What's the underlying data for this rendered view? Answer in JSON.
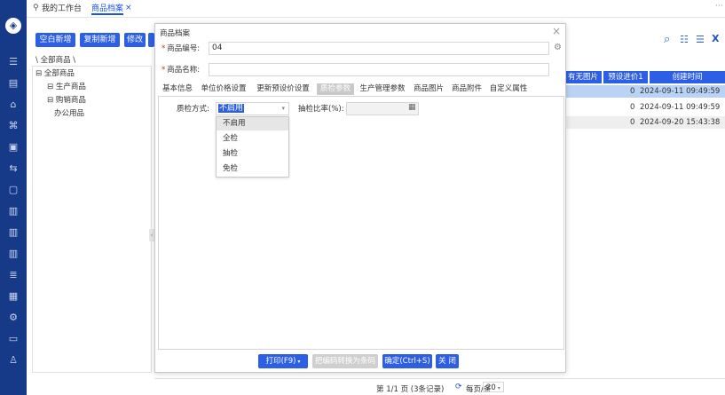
{
  "topbar": {
    "tabs": [
      {
        "label": "我的工作台",
        "active": false
      },
      {
        "label": "商品档案",
        "active": true
      }
    ],
    "more": "···"
  },
  "leftnav": {
    "icons": [
      "home-icon",
      "task-icon",
      "cart-icon",
      "bank-icon",
      "monitor-icon",
      "transfer-icon",
      "doc-icon",
      "file-icon",
      "file-icon",
      "file-icon",
      "list-icon",
      "report-icon",
      "settings-icon",
      "screen-icon",
      "user-icon"
    ]
  },
  "background": {
    "toolbar": {
      "blank_new": "空白新增",
      "copy_new": "复制新增",
      "edit": "修改"
    },
    "breadcrumb": "\\ 全部商品 \\",
    "tree": [
      "⊟ 全部商品",
      "⊟ 生产商品",
      "⊟ 购销商品",
      "办公用品"
    ],
    "grid": {
      "headers": [
        "有无图片",
        "预设进价1",
        "创建时间"
      ],
      "rows": [
        {
          "price": "0",
          "created": "2024-09-11 09:49:59"
        },
        {
          "price": "0",
          "created": "2024-09-11 09:49:59"
        },
        {
          "price": "0",
          "created": "2024-09-20 15:43:38"
        }
      ]
    },
    "pager": "第 1/1 页 (3条记录)",
    "per_page_label": "每页/条",
    "per_page_value": "20"
  },
  "modal": {
    "title": "商品档案",
    "close": "×",
    "code_label": "商品编号:",
    "code_value": "04",
    "name_label": "商品名称:",
    "name_value": "",
    "tabs": [
      "基本信息",
      "单位价格设置",
      "更新预设价设置",
      "质检参数",
      "生产管理参数",
      "商品图片",
      "商品附件",
      "自定义属性"
    ],
    "active_tab": 3,
    "qc_label": "质检方式:",
    "qc_value": "不启用",
    "ratio_label": "抽检比率(%):",
    "ratio_value": "",
    "dropdown_options": [
      "不启用",
      "全检",
      "抽检",
      "免检"
    ],
    "footer": {
      "print": "打印(F9)",
      "convert": "把编码转换为条码",
      "confirm": "确定(Ctrl+S)",
      "close": "关 闭"
    }
  },
  "colors": {
    "nav": "#163a88",
    "primary": "#2d5fe5",
    "required": "#e02020"
  }
}
